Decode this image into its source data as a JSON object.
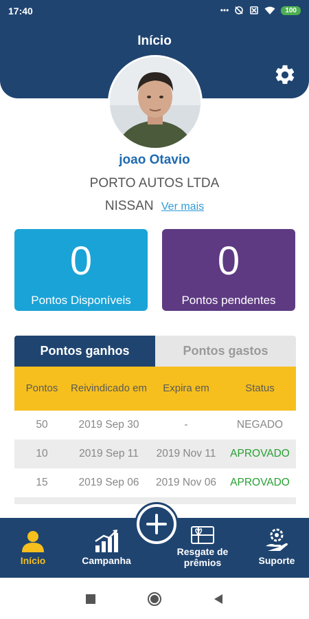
{
  "status_bar": {
    "time": "17:40",
    "battery": "100"
  },
  "header": {
    "title": "Início"
  },
  "profile": {
    "name": "joao Otavio",
    "company": "PORTO AUTOS LTDA",
    "brand": "NISSAN",
    "more_link": "Ver mais"
  },
  "cards": {
    "available": {
      "value": "0",
      "label": "Pontos Disponíveis"
    },
    "pending": {
      "value": "0",
      "label": "Pontos pendentes"
    }
  },
  "tabs": {
    "earned": "Pontos ganhos",
    "spent": "Pontos gastos"
  },
  "table": {
    "headers": [
      "Pontos",
      "Reivindicado em",
      "Expira em",
      "Status"
    ],
    "rows": [
      {
        "points": "50",
        "claimed": "2019 Sep 30",
        "expires": "-",
        "status": "NEGADO"
      },
      {
        "points": "10",
        "claimed": "2019 Sep 11",
        "expires": "2019 Nov 11",
        "status": "APROVADO"
      },
      {
        "points": "15",
        "claimed": "2019 Sep 06",
        "expires": "2019 Nov 06",
        "status": "APROVADO"
      }
    ]
  },
  "bottom_nav": {
    "home": "Início",
    "campaign": "Campanha",
    "rewards": "Resgate de prêmios",
    "support": "Suporte"
  },
  "icons": {
    "settings": "gear-icon",
    "add": "plus-icon",
    "home": "user-icon",
    "campaign": "chart-icon",
    "rewards": "gift-card-icon",
    "support": "support-icon"
  },
  "colors": {
    "primary": "#1f4470",
    "accent_yellow": "#f6bf1d",
    "card_blue": "#1aa3d6",
    "card_purple": "#5e3a82",
    "approved": "#27a033"
  }
}
